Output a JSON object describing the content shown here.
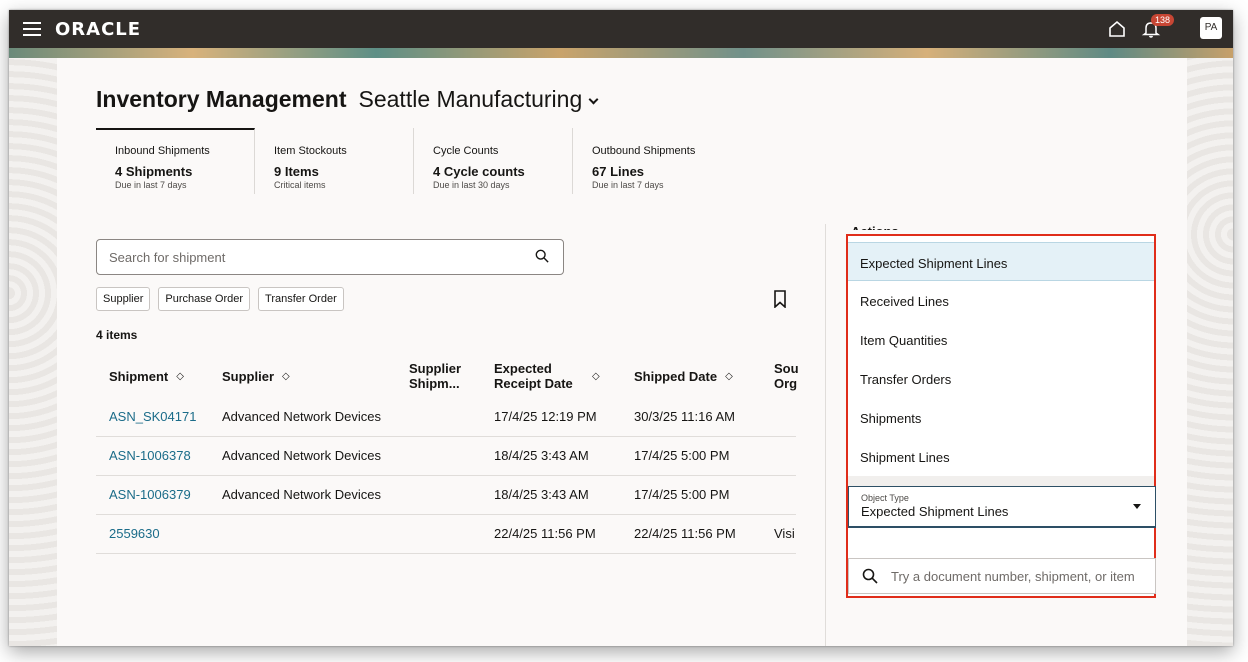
{
  "topbar": {
    "brand": "ORACLE",
    "notification_count": "138",
    "avatar": "PA",
    "icons": [
      "hamburger-icon",
      "home-icon",
      "bell-icon"
    ]
  },
  "page": {
    "title": "Inventory Management",
    "org": "Seattle Manufacturing"
  },
  "metrics": [
    {
      "label": "Inbound Shipments",
      "value": "4 Shipments",
      "sub": "Due in last 7 days"
    },
    {
      "label": "Item Stockouts",
      "value": "9 Items",
      "sub": "Critical items"
    },
    {
      "label": "Cycle Counts",
      "value": "4 Cycle counts",
      "sub": "Due in last 30 days"
    },
    {
      "label": "Outbound Shipments",
      "value": "67 Lines",
      "sub": "Due in last 7 days"
    }
  ],
  "search": {
    "placeholder": "Search for shipment"
  },
  "filters": [
    "Supplier",
    "Purchase Order",
    "Transfer Order"
  ],
  "results_count": "4 items",
  "table": {
    "columns": [
      "Shipment",
      "Supplier",
      "Supplier Shipm...",
      "Expected Receipt Date",
      "Shipped Date",
      "Sou Org"
    ],
    "rows": [
      {
        "shipment": "ASN_SK04171",
        "supplier": "Advanced Network Devices",
        "expected": "17/4/25 12:19 PM",
        "shipped": "30/3/25 11:16 AM",
        "source": ""
      },
      {
        "shipment": "ASN-1006378",
        "supplier": "Advanced Network Devices",
        "expected": "18/4/25 3:43 AM",
        "shipped": "17/4/25 5:00 PM",
        "source": ""
      },
      {
        "shipment": "ASN-1006379",
        "supplier": "Advanced Network Devices",
        "expected": "18/4/25 3:43 AM",
        "shipped": "17/4/25 5:00 PM",
        "source": ""
      },
      {
        "shipment": "2559630",
        "supplier": "",
        "expected": "22/4/25 11:56 PM",
        "shipped": "22/4/25 11:56 PM",
        "source": "Visi"
      }
    ]
  },
  "actions": {
    "label": "Actions",
    "options": [
      "Expected Shipment Lines",
      "Received Lines",
      "Item Quantities",
      "Transfer Orders",
      "Shipments",
      "Shipment Lines"
    ],
    "object_type_label": "Object Type",
    "object_type_value": "Expected Shipment Lines",
    "search_placeholder": "Try a document number, shipment, or item"
  },
  "colors": {
    "accent_highlight": "#e02d1a",
    "link": "#1b6c89",
    "topbar": "#312d2a",
    "badge": "#c74634"
  }
}
